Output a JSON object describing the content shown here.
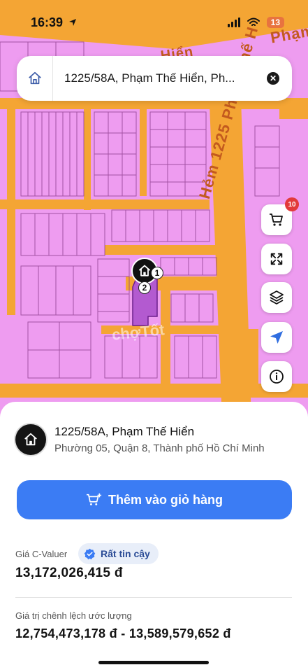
{
  "status": {
    "time": "16:39",
    "battery": "13"
  },
  "search": {
    "value": "1225/58A, Phạm Thế Hiển, Ph..."
  },
  "map": {
    "street_top_right": "Phạm",
    "street_vertical": "Hẻm 1225 Phạm Thế H",
    "street_hien": "Hiển",
    "watermark": "chợTốt",
    "marker_1": "1",
    "marker_2": "2"
  },
  "side_buttons": {
    "cart_count": "10",
    "items": [
      "cart-icon",
      "expand-icon",
      "layers-icon",
      "locate-icon",
      "info-icon"
    ]
  },
  "address": {
    "title": "1225/58A, Phạm Thế Hiển",
    "subtitle": "Phường 05, Quận 8, Thành phố Hồ Chí Minh"
  },
  "add_to_cart_label": "Thêm vào giỏ hàng",
  "valuation": {
    "label": "Giá C-Valuer",
    "badge": "Rất tin cậy",
    "value": "13,172,026,415 đ",
    "range_label": "Giá trị chênh lệch ước lượng",
    "range_value": "12,754,473,178 đ - 13,589,579,652 đ"
  },
  "colors": {
    "accent": "#3b7cf4",
    "map_lot": "#ee9cf0",
    "map_road": "#f4a534",
    "cart_badge": "#e23a3a"
  }
}
